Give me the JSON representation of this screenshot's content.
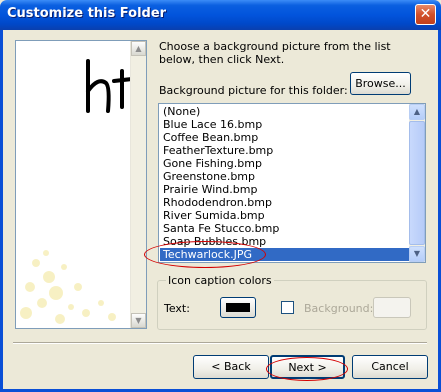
{
  "window": {
    "title": "Customize this Folder",
    "close_glyph": "✕"
  },
  "instructions": "Choose a background picture from the list below, then click Next.",
  "list_label": "Background picture for this folder:",
  "browse_label": "Browse...",
  "pictures": [
    "(None)",
    "Blue Lace 16.bmp",
    "Coffee Bean.bmp",
    "FeatherTexture.bmp",
    "Gone Fishing.bmp",
    "Greenstone.bmp",
    "Prairie Wind.bmp",
    "Rhododendron.bmp",
    "River Sumida.bmp",
    "Santa Fe Stucco.bmp",
    "Soap Bubbles.bmp",
    "Techwarlock.JPG"
  ],
  "selected_picture": "Techwarlock.JPG",
  "caption_colors": {
    "group_title": "Icon caption colors",
    "text_label": "Text:",
    "text_color": "#000000",
    "background_label": "Background:",
    "background_checked": false
  },
  "buttons": {
    "back": "< Back",
    "next": "Next >",
    "cancel": "Cancel"
  },
  "colors": {
    "title_bar": "#0054e3",
    "selection": "#316ac5",
    "annotation": "#d40000",
    "dialog_bg": "#ece9d8"
  },
  "icons": {
    "scroll_up": "▲",
    "scroll_down": "▼"
  }
}
